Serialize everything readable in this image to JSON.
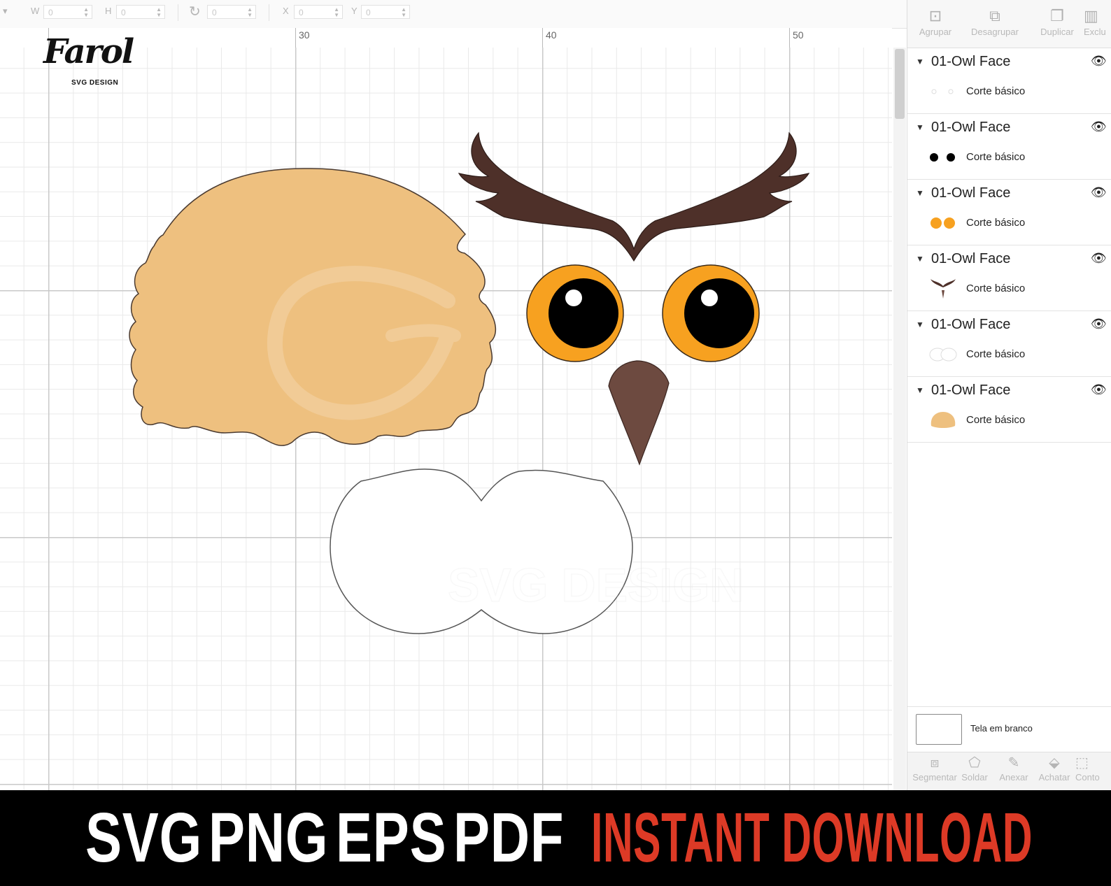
{
  "toolbar": {
    "w_label": "W",
    "h_label": "H",
    "x_label": "X",
    "y_label": "Y",
    "w_value": "0",
    "h_value": "0",
    "rotate_value": "0",
    "x_value": "0",
    "y_value": "0"
  },
  "ruler": {
    "marks": [
      "30",
      "40",
      "50"
    ]
  },
  "logo": {
    "word": "Farol",
    "sub": "SVG DESIGN"
  },
  "watermark": {
    "text": "SVG DESIGN"
  },
  "panel": {
    "tools": [
      {
        "label": "Agrupar",
        "icon": "group-icon"
      },
      {
        "label": "Desagrupar",
        "icon": "ungroup-icon"
      },
      {
        "label": "Duplicar",
        "icon": "duplicate-icon"
      },
      {
        "label": "Exclu",
        "icon": "delete-icon"
      }
    ],
    "layers": [
      {
        "name": "01-Owl Face",
        "cut": "Corte básico",
        "thumb": "white-dots"
      },
      {
        "name": "01-Owl Face",
        "cut": "Corte básico",
        "thumb": "black-dots"
      },
      {
        "name": "01-Owl Face",
        "cut": "Corte básico",
        "thumb": "orange-dots"
      },
      {
        "name": "01-Owl Face",
        "cut": "Corte básico",
        "thumb": "brows"
      },
      {
        "name": "01-Owl Face",
        "cut": "Corte básico",
        "thumb": "white-shape"
      },
      {
        "name": "01-Owl Face",
        "cut": "Corte básico",
        "thumb": "tan-shape"
      }
    ],
    "blank_canvas_label": "Tela em branco",
    "bottom_tools": [
      {
        "label": "Segmentar",
        "icon": "slice-icon"
      },
      {
        "label": "Soldar",
        "icon": "weld-icon"
      },
      {
        "label": "Anexar",
        "icon": "attach-icon"
      },
      {
        "label": "Achatar",
        "icon": "flatten-icon"
      },
      {
        "label": "Conto",
        "icon": "contour-icon"
      }
    ]
  },
  "banner": {
    "formats": [
      "SVG",
      "PNG",
      "EPS",
      "PDF"
    ],
    "cta": "INSTANT DOWNLOAD"
  },
  "colors": {
    "tan": "#eec07f",
    "brow": "#4e3029",
    "beak": "#6d4a40",
    "iris": "#f7a120",
    "pupil": "#000000",
    "cta_red": "#dd3a26"
  }
}
